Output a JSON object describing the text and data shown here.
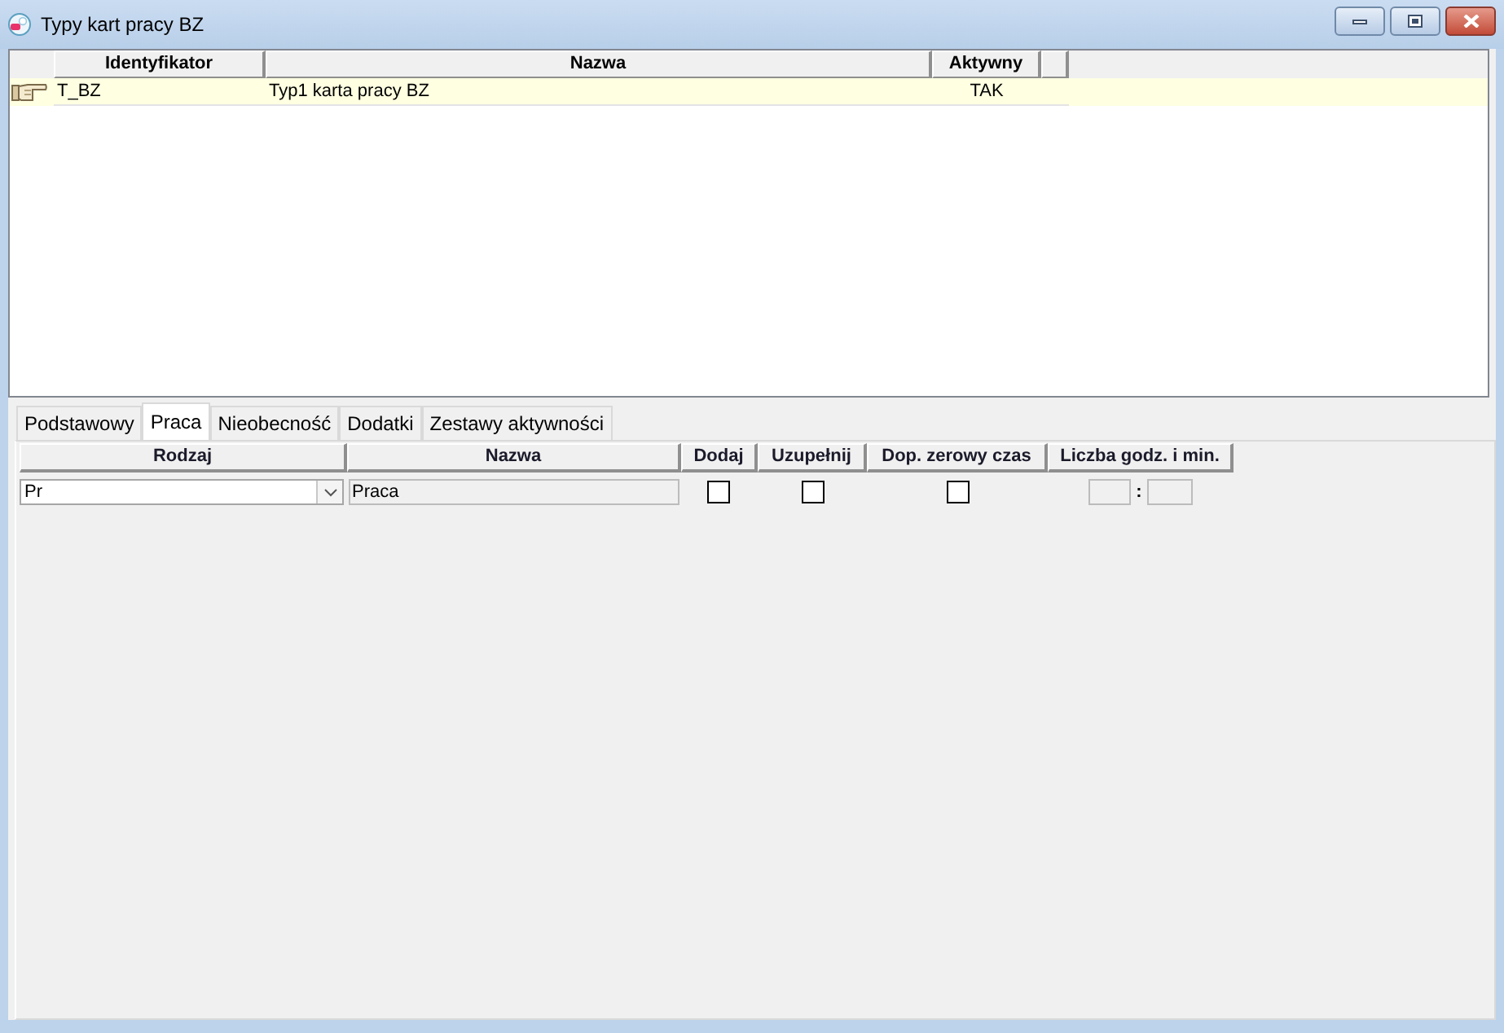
{
  "window": {
    "title": "Typy kart pracy BZ"
  },
  "grid": {
    "columns": [
      "Identyfikator",
      "Nazwa",
      "Aktywny"
    ],
    "rows": [
      {
        "selected": true,
        "cells": [
          "T_BZ",
          "Typ1 karta pracy BZ",
          "TAK"
        ]
      }
    ]
  },
  "tabs": [
    {
      "label": "Podstawowy",
      "selected": false
    },
    {
      "label": "Praca",
      "selected": true
    },
    {
      "label": "Nieobecność",
      "selected": false
    },
    {
      "label": "Dodatki",
      "selected": false
    },
    {
      "label": "Zestawy aktywności",
      "selected": false
    }
  ],
  "detail": {
    "columns": [
      "Rodzaj",
      "Nazwa",
      "Dodaj",
      "Uzupełnij",
      "Dop. zerowy czas",
      "Liczba godz. i min."
    ],
    "rows": [
      {
        "rodzaj": {
          "value": "Pr"
        },
        "nazwa": {
          "value": "Praca",
          "disabled": true
        },
        "dodaj": {
          "checked": false
        },
        "uzupelnij": {
          "checked": false
        },
        "dop_zerowy_czas": {
          "checked": false
        },
        "time": {
          "separator": ":",
          "disabled": true
        }
      }
    ]
  }
}
